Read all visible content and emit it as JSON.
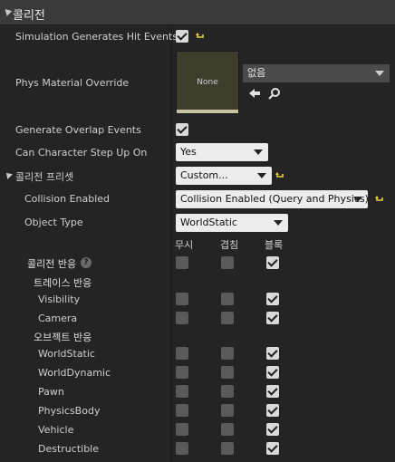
{
  "section": {
    "title": "콜리전"
  },
  "properties": {
    "sim_hit": {
      "label": "Simulation Generates Hit Events",
      "checked": true
    },
    "phys_material": {
      "label": "Phys Material Override",
      "thumbnail_text": "None",
      "value": "없음"
    },
    "overlap": {
      "label": "Generate Overlap Events",
      "checked": true
    },
    "step_up": {
      "label": "Can Character Step Up On",
      "value": "Yes"
    },
    "preset": {
      "label": "콜리전 프리셋",
      "value": "Custom..."
    },
    "collision_enabled": {
      "label": "Collision Enabled",
      "value": "Collision Enabled (Query and Physics)"
    },
    "object_type": {
      "label": "Object Type",
      "value": "WorldStatic"
    }
  },
  "responses": {
    "columns": [
      "무시",
      "겹침",
      "블록"
    ],
    "header_label": "콜리전 반응",
    "trace_label": "트레이스 반응",
    "object_label": "오브젝트 반응",
    "rows": [
      {
        "label": "",
        "state": [
          "off",
          "off",
          "on"
        ]
      },
      {
        "label": "Visibility",
        "state": [
          "off",
          "off",
          "on"
        ]
      },
      {
        "label": "Camera",
        "state": [
          "off",
          "off",
          "on"
        ]
      },
      {
        "label": "WorldStatic",
        "state": [
          "off",
          "off",
          "on"
        ]
      },
      {
        "label": "WorldDynamic",
        "state": [
          "off",
          "off",
          "on"
        ]
      },
      {
        "label": "Pawn",
        "state": [
          "off",
          "off",
          "on"
        ]
      },
      {
        "label": "PhysicsBody",
        "state": [
          "off",
          "off",
          "on"
        ]
      },
      {
        "label": "Vehicle",
        "state": [
          "off",
          "off",
          "on"
        ]
      },
      {
        "label": "Destructible",
        "state": [
          "off",
          "off",
          "on"
        ]
      }
    ]
  },
  "colors": {
    "reset_arrow": "#e8d23a",
    "panel_bg": "#242424",
    "header_bg": "#3a3a3a"
  },
  "icons": {
    "reset": "reset-to-default-icon",
    "use_selected": "left-arrow-icon",
    "browse": "magnifier-icon",
    "help": "question-icon"
  }
}
